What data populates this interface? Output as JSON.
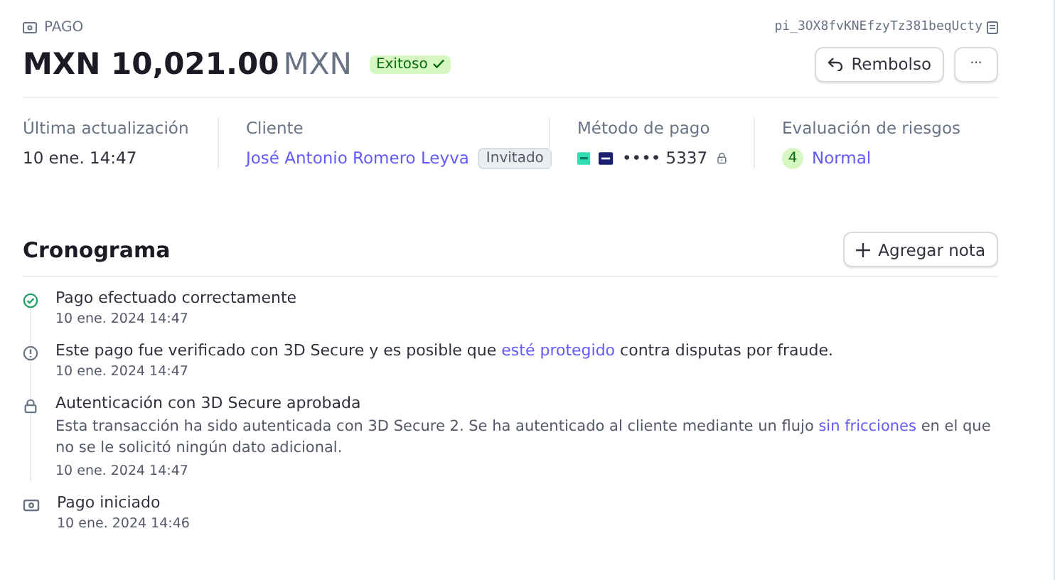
{
  "header": {
    "section_label": "PAGO",
    "payment_id": "pi_3OX8fvKNEfzyTz381beqUcty",
    "amount": "MXN 10,021.00",
    "currency": "MXN",
    "status": "Exitoso",
    "buttons": [
      {
        "kind": "refund",
        "label": "Rembolso"
      },
      {
        "kind": "more",
        "label": "···"
      }
    ]
  },
  "details": [
    {
      "kind": "text",
      "label": "Última actualización",
      "value": "10 ene. 14:47"
    },
    {
      "kind": "customer",
      "label": "Cliente",
      "value": "José Antonio Romero Leyva",
      "badge": "Invitado"
    },
    {
      "kind": "payment",
      "label": "Método de pago",
      "value": "•••• 5337"
    },
    {
      "kind": "risk",
      "label": "Evaluación de riesgos",
      "score": "4",
      "value": "Normal"
    }
  ],
  "timeline": {
    "title": "Cronograma",
    "button": "Agregar nota",
    "events": [
      {
        "kind": "success",
        "title": "Pago efectuado correctamente",
        "time": "10 ene. 2024 14:47"
      },
      {
        "kind": "info",
        "title_parts": {
          "before": "Este pago fue verificado con 3D Secure y es posible que ",
          "link": "esté protegido",
          "after": " contra disputas por fraude."
        },
        "time": "10 ene. 2024 14:47"
      },
      {
        "kind": "lock",
        "title": "Autenticación con 3D Secure aprobada",
        "description_parts": {
          "before": "Esta transacción ha sido autenticada con 3D Secure 2. Se ha autenticado al cliente mediante un flujo ",
          "link": "sin fricciones",
          "after": " en el que no se le solicitó ningún dato adicional."
        },
        "time": "10 ene. 2024 14:47"
      },
      {
        "kind": "payment",
        "title": "Pago iniciado",
        "time": "10 ene. 2024 14:46"
      }
    ]
  }
}
